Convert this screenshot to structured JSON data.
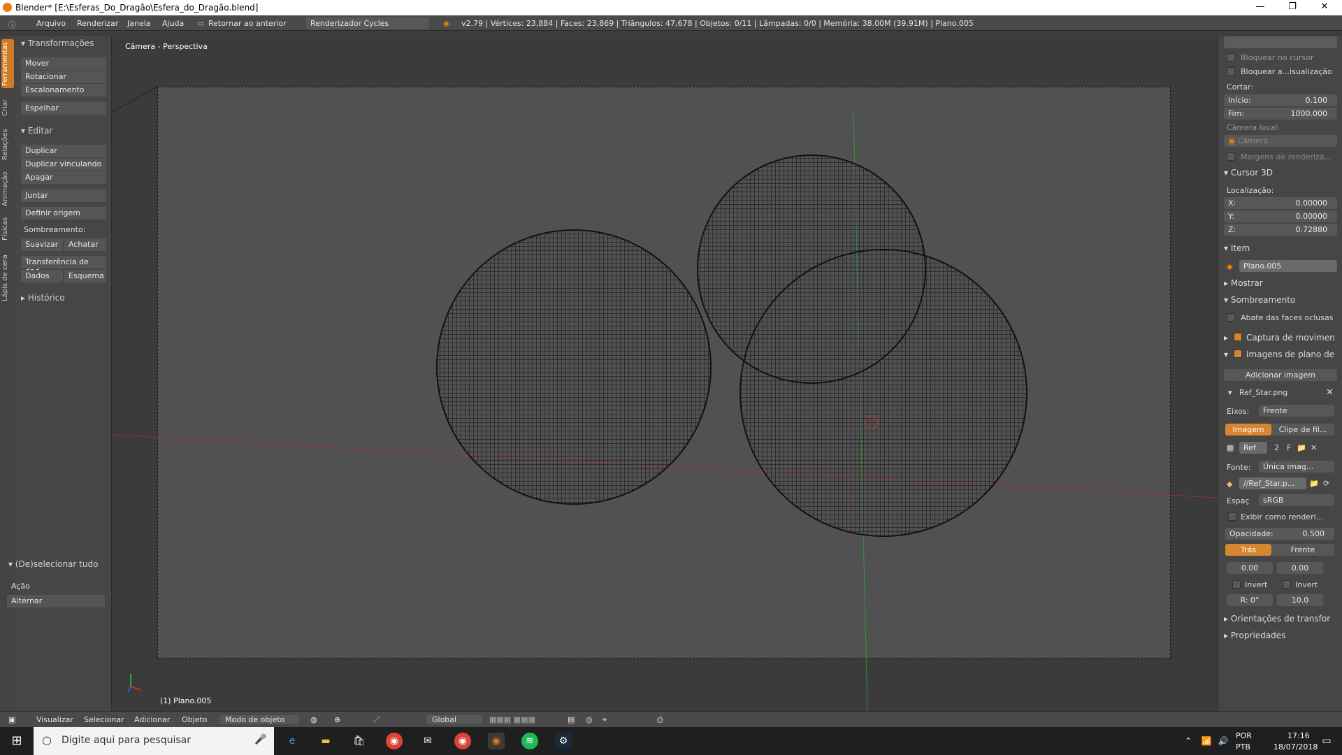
{
  "window": {
    "title": "Blender* [E:\\Esferas_Do_Dragão\\Esfera_do_Dragão.blend]"
  },
  "infobar": {
    "menus": [
      "Arquivo",
      "Renderizar",
      "Janela",
      "Ajuda"
    ],
    "back_label": "Retornar ao anterior",
    "renderer": "Renderizador Cycles",
    "stats": "v2.79 | Vértices: 23,884 | Faces: 23,869 | Triângulos: 47,678 | Objetos: 0/11 | Lâmpadas: 0/0 | Memória: 38.00M (39.91M) | Plano.005"
  },
  "left_tabs": [
    "Ferramentas",
    "Criar",
    "Relações",
    "Animação",
    "Físicas",
    "Lápis de cera"
  ],
  "toolshelf": {
    "transform_header": "Transformações",
    "transform_items": [
      "Mover",
      "Rotacionar",
      "Escalonamento",
      "Espelhar"
    ],
    "edit_header": "Editar",
    "edit_items": [
      "Duplicar",
      "Duplicar vinculando",
      "Apagar",
      "Juntar"
    ],
    "origin_label": "Definir origem",
    "shading_label": "Sombreamento:",
    "smooth_label": "Suavizar",
    "flat_label": "Achatar",
    "transfer_label": "Transferência de dad...",
    "data_label": "Dados",
    "schema_label": "Esquema",
    "history_header": "Histórico",
    "deselect_header": "(De)selecionar tudo",
    "action_label": "Ação",
    "action_value": "Alternar"
  },
  "viewport": {
    "view_label": "Câmera - Perspectiva",
    "object_label": "(1) Plano.005"
  },
  "props": {
    "lock_cursor": "Bloquear no cursor",
    "lock_view": "Bloquear a...isualização",
    "clip_label": "Cortar:",
    "clip_start_label": "Início:",
    "clip_start_value": "0.100",
    "clip_end_label": "Fim:",
    "clip_end_value": "1000.000",
    "local_camera_label": "Câmera local:",
    "local_camera_value": "Câmera",
    "render_border": "Margens de renderiza...",
    "cursor_header": "Cursor 3D",
    "location_label": "Localização:",
    "x_label": "X:",
    "x_value": "0.00000",
    "y_label": "Y:",
    "y_value": "0.00000",
    "z_label": "Z:",
    "z_value": "0.72880",
    "item_header": "Item",
    "item_name": "Plano.005",
    "display_header": "Mostrar",
    "shading_header": "Sombreamento",
    "backface_label": "Abate das faces oclusas",
    "motion_tracking": "Captura de movimen",
    "background_images": "Imagens de plano de",
    "add_image": "Adicionar imagem",
    "image_name": "Ref_Star.png",
    "axis_label": "Eixos:",
    "axis_value": "Frente",
    "tab_image": "Imagem",
    "tab_clip": "Clipe de fil...",
    "ref_label": "Ref",
    "ref_count": "2",
    "ref_f": "F",
    "source_label": "Fonte:",
    "source_value": "Única imag...",
    "file_path": "//Ref_Star.p...",
    "color_space_label": "Espaç",
    "color_space_value": "sRGB",
    "show_render": "Exibir como renderi...",
    "opacity_label": "Opacidade:",
    "opacity_value": "0.500",
    "back_btn": "Trás",
    "front_btn": "Frente",
    "offset_x": "0.00",
    "offset_y": "0.00",
    "invert_1": "Invert",
    "invert_2": "Invert",
    "rotation": "R: 0°",
    "size": "10.0",
    "orient_header": "Orientações de transfor",
    "props_header": "Propriedades"
  },
  "vheader": {
    "menus": [
      "Visualizar",
      "Selecionar",
      "Adicionar",
      "Objeto"
    ],
    "mode": "Modo de objeto",
    "orientation": "Global"
  },
  "taskbar": {
    "search_placeholder": "Digite aqui para pesquisar",
    "lang1": "POR",
    "lang2": "PTB",
    "time": "17:16",
    "date": "18/07/2018"
  },
  "colors": {
    "accent": "#d5862e",
    "panel_bg": "#464646",
    "viewport_bg": "#3b3b3b",
    "camera_bg": "#515151"
  }
}
